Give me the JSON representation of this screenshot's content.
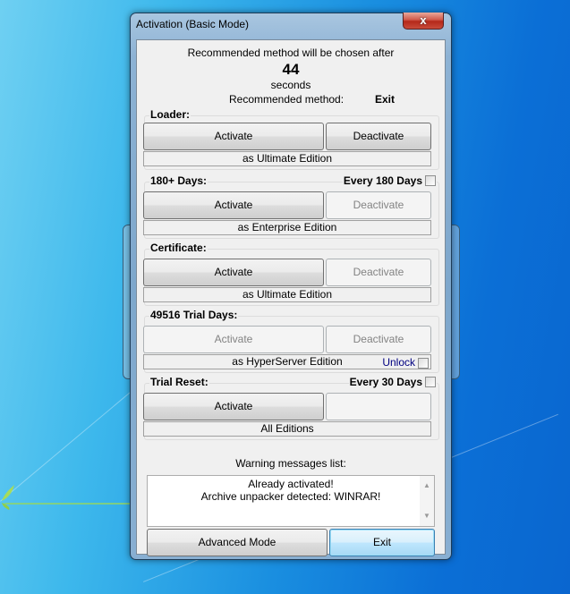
{
  "window": {
    "title": "Activation (Basic Mode)",
    "close_label": "x"
  },
  "header": {
    "countdown_text": "Recommended method will be chosen after",
    "countdown_value": "44",
    "countdown_unit": "seconds",
    "recommended_label": "Recommended method:",
    "recommended_value": "Exit"
  },
  "groups": [
    {
      "title": "Loader:",
      "right_label": "",
      "activate": {
        "label": "Activate",
        "enabled": true
      },
      "deactivate": {
        "label": "Deactivate",
        "enabled": true
      },
      "edition": "as Ultimate Edition"
    },
    {
      "title": "180+ Days:",
      "right_label": "Every 180 Days",
      "right_checked": false,
      "activate": {
        "label": "Activate",
        "enabled": true
      },
      "deactivate": {
        "label": "Deactivate",
        "enabled": false
      },
      "edition": "as Enterprise Edition"
    },
    {
      "title": "Certificate:",
      "right_label": "",
      "activate": {
        "label": "Activate",
        "enabled": true
      },
      "deactivate": {
        "label": "Deactivate",
        "enabled": false
      },
      "edition": "as Ultimate Edition"
    },
    {
      "title": "49516 Trial Days:",
      "right_label": "",
      "activate": {
        "label": "Activate",
        "enabled": false
      },
      "deactivate": {
        "label": "Deactivate",
        "enabled": false
      },
      "edition": "as HyperServer Edition",
      "unlock_label": "Unlock",
      "unlock_checked": false
    },
    {
      "title": "Trial Reset:",
      "right_label": "Every 30 Days",
      "right_checked": false,
      "activate": {
        "label": "Activate",
        "enabled": true
      },
      "deactivate": {
        "label": "",
        "enabled": false
      },
      "edition": "All Editions"
    }
  ],
  "messages": {
    "label": "Warning messages list:",
    "lines": [
      "Already activated!",
      "Archive unpacker detected: WINRAR!"
    ]
  },
  "footer": {
    "advanced_label": "Advanced Mode",
    "exit_label": "Exit"
  }
}
